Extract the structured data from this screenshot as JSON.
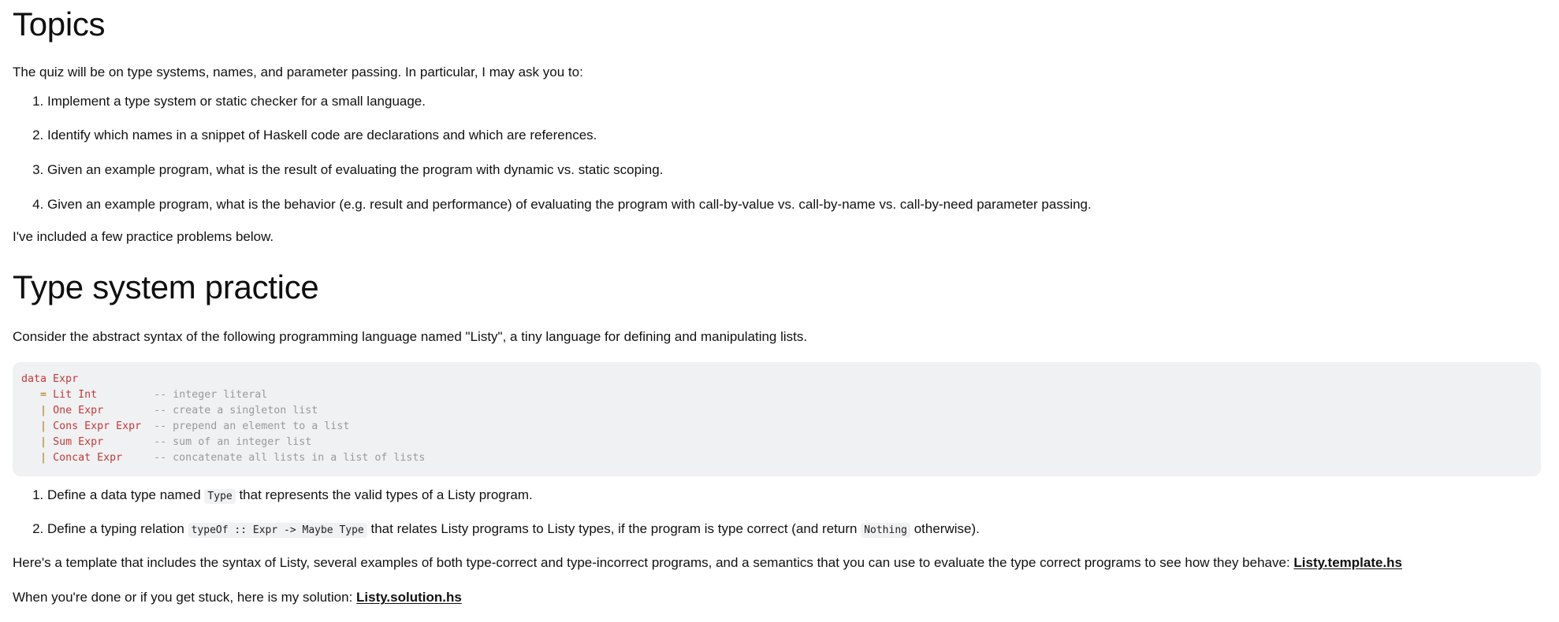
{
  "topics": {
    "heading": "Topics",
    "intro": "The quiz will be on type systems, names, and parameter passing. In particular, I may ask you to:",
    "items": [
      "Implement a type system or static checker for a small language.",
      "Identify which names in a snippet of Haskell code are declarations and which are references.",
      "Given an example program, what is the result of evaluating the program with dynamic vs. static scoping.",
      "Given an example program, what is the behavior (e.g. result and performance) of evaluating the program with call-by-value vs. call-by-name vs. call-by-need parameter passing."
    ],
    "after": "I've included a few practice problems below."
  },
  "practice": {
    "heading": "Type system practice",
    "description": "Consider the abstract syntax of the following programming language named \"Listy\", a tiny language for defining and manipulating lists.",
    "code": {
      "line1_kw": "data",
      "line1_name": "Expr",
      "lines": [
        {
          "op": "=",
          "ctor": "Lit Int",
          "pad": "         ",
          "comment": "-- integer literal"
        },
        {
          "op": "|",
          "ctor": "One Expr",
          "pad": "        ",
          "comment": "-- create a singleton list"
        },
        {
          "op": "|",
          "ctor": "Cons Expr Expr",
          "pad": "  ",
          "comment": "-- prepend an element to a list"
        },
        {
          "op": "|",
          "ctor": "Sum Expr",
          "pad": "        ",
          "comment": "-- sum of an integer list"
        },
        {
          "op": "|",
          "ctor": "Concat Expr",
          "pad": "     ",
          "comment": "-- concatenate all lists in a list of lists"
        }
      ]
    },
    "tasks": {
      "t1_before": "Define a data type named ",
      "t1_code": "Type",
      "t1_after": " that represents the valid types of a Listy program.",
      "t2_before": "Define a typing relation ",
      "t2_code": "typeOf :: Expr -> Maybe Type",
      "t2_mid": " that relates Listy programs to Listy types, if the program is type correct (and return ",
      "t2_code2": "Nothing",
      "t2_after": " otherwise)."
    },
    "template_text": "Here's a template that includes the syntax of Listy, several examples of both type-correct and type-incorrect programs, and a semantics that you can use to evaluate the type correct programs to see how they behave: ",
    "template_link": "Listy.template.hs",
    "solution_text": "When you're done or if you get stuck, here is my solution: ",
    "solution_link": "Listy.solution.hs"
  }
}
